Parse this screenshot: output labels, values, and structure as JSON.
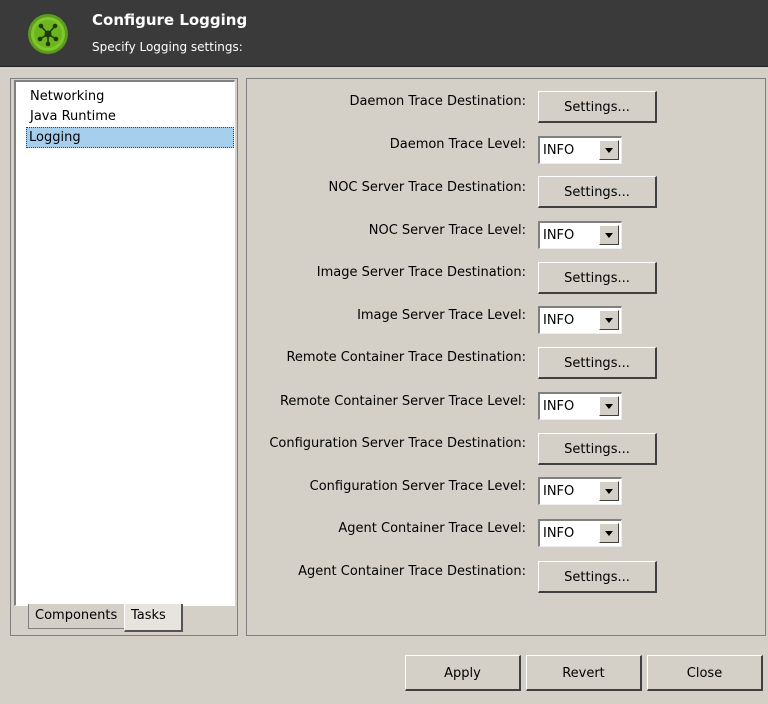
{
  "header": {
    "title": "Configure Logging",
    "subtitle": "Specify Logging settings:",
    "icon": "network-hub-icon",
    "icon_color": "#7dc82a"
  },
  "sidebar": {
    "items": [
      {
        "label": "Networking",
        "selected": false
      },
      {
        "label": "Java Runtime",
        "selected": false
      },
      {
        "label": "Logging",
        "selected": true
      }
    ],
    "tabs": [
      {
        "label": "Components",
        "active": false
      },
      {
        "label": "Tasks",
        "active": true
      }
    ],
    "selection_color": "#a6cfee"
  },
  "settings": {
    "rows": [
      {
        "label": "Daemon Trace Destination:",
        "type": "button",
        "value": "Settings..."
      },
      {
        "label": "Daemon Trace Level:",
        "type": "select",
        "value": "INFO"
      },
      {
        "label": "NOC Server Trace Destination:",
        "type": "button",
        "value": "Settings..."
      },
      {
        "label": "NOC Server Trace Level:",
        "type": "select",
        "value": "INFO"
      },
      {
        "label": "Image Server Trace Destination:",
        "type": "button",
        "value": "Settings..."
      },
      {
        "label": "Image Server Trace Level:",
        "type": "select",
        "value": "INFO"
      },
      {
        "label": "Remote Container Trace Destination:",
        "type": "button",
        "value": "Settings..."
      },
      {
        "label": "Remote Container Server Trace Level:",
        "type": "select",
        "value": "INFO"
      },
      {
        "label": "Configuration Server Trace Destination:",
        "type": "button",
        "value": "Settings..."
      },
      {
        "label": "Configuration Server Trace Level:",
        "type": "select",
        "value": "INFO"
      },
      {
        "label": "Agent Container Trace Level:",
        "type": "select",
        "value": "INFO"
      },
      {
        "label": "Agent Container Trace Destination:",
        "type": "button",
        "value": "Settings..."
      }
    ]
  },
  "footer": {
    "apply_label": "Apply",
    "revert_label": "Revert",
    "close_label": "Close"
  }
}
